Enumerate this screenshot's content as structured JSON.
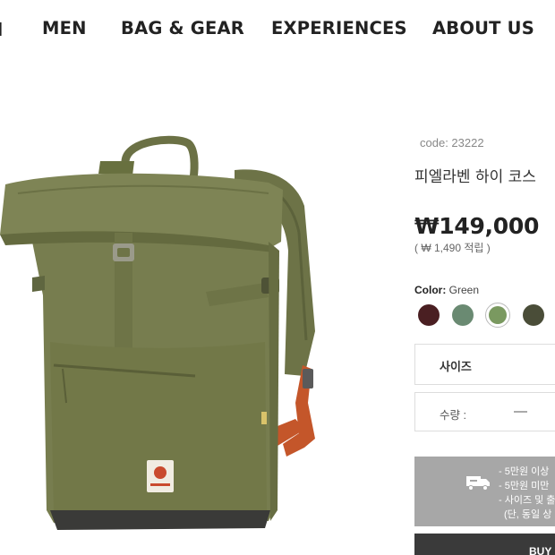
{
  "nav": {
    "edge_fragment": "I",
    "items": [
      "MEN",
      "BAG & GEAR",
      "EXPERIENCES",
      "ABOUT US"
    ]
  },
  "product": {
    "code": "code: 23222",
    "name": "피엘라벤 하이 코스",
    "price": "₩149,000",
    "points": "( ₩ 1,490 적립 )",
    "color_label": "Color:",
    "color_value": "Green",
    "swatches": [
      {
        "name": "dark-red",
        "color": "#4a1f22"
      },
      {
        "name": "sage",
        "color": "#6a8a72"
      },
      {
        "name": "green",
        "color": "#7a9960",
        "selected": true
      },
      {
        "name": "dark-olive",
        "color": "#4a4d38"
      }
    ],
    "size_label": "사이즈",
    "qty_label": "수량 :",
    "qty_minus": "—"
  },
  "shipping": {
    "lines": [
      "- 5만원 이상",
      "- 5만원 미만",
      "- 사이즈 및 출",
      "(단, 동일 상"
    ]
  },
  "buy_label": "BUY",
  "colors": {
    "bag_body": "#747a4d",
    "strap_accent": "#c4562a",
    "shipping_bg": "#a7a7a7",
    "buy_bg": "#3a3a3a"
  }
}
